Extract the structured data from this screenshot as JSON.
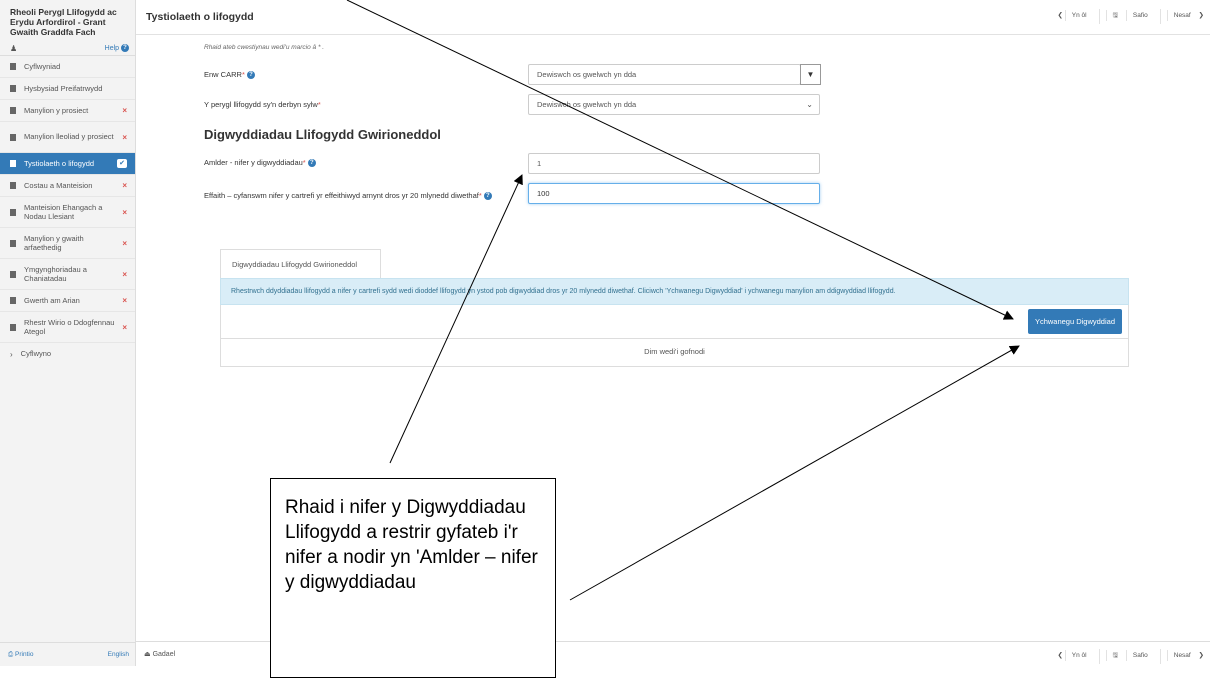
{
  "sidebar": {
    "title": "Rheoli Perygl Llifogydd ac Erydu Arfordirol - Grant Gwaith Graddfa Fach",
    "help": "Help",
    "items": [
      {
        "label": "Cyflwyniad",
        "mark": ""
      },
      {
        "label": "Hysbysiad Preifatrwydd",
        "mark": ""
      },
      {
        "label": "Manylion y prosiect",
        "mark": "×"
      },
      {
        "label": "Manylion lleoliad y prosiect",
        "mark": "×"
      },
      {
        "label": "Tystiolaeth o lifogydd",
        "mark": "✔"
      },
      {
        "label": "Costau a Manteision",
        "mark": "×"
      },
      {
        "label": "Manteision Ehangach a Nodau Llesiant",
        "mark": "×"
      },
      {
        "label": "Manylion y gwaith arfaethedig",
        "mark": "×"
      },
      {
        "label": "Ymgynghoriadau a Chaniatadau",
        "mark": "×"
      },
      {
        "label": "Gwerth am Arian",
        "mark": "×"
      },
      {
        "label": "Rhestr Wirio o Ddogfennau Ategol",
        "mark": "×"
      },
      {
        "label": "Cyflwyno",
        "mark": ""
      }
    ],
    "print": "Printio",
    "language": "English"
  },
  "header": {
    "title": "Tystiolaeth o lifogydd",
    "back": "Yn ôl",
    "save": "Safio",
    "next": "Nesaf"
  },
  "footer": {
    "leave": "Gadael"
  },
  "form": {
    "required_note": "Rhaid ateb cwestiynau wedi'u marcio â * .",
    "carr_label": "Enw CARR",
    "carr_placeholder": "Dewiswch os gwelwch yn dda",
    "risk_label": "Y perygl llifogydd sy'n derbyn sylw",
    "risk_value": "Dewiswch os gwelwch yn dda",
    "section_heading": "Digwyddiadau Llifogydd Gwirioneddol",
    "freq_label": "Amlder - nifer y digwyddiadau",
    "freq_value": "1",
    "impact_label": "Effaith – cyfanswm nifer y cartrefi yr effeithiwyd arnynt dros yr 20 mlynedd diwethaf",
    "impact_value": "100"
  },
  "panel": {
    "tab": "Digwyddiadau Llifogydd Gwirioneddol",
    "info": "Rhestrwch ddyddiadau llifogydd a nifer y cartrefi sydd wedi dioddef llifogydd yn ystod pob digwyddiad dros yr 20 mlynedd diwethaf. Cliciwch 'Ychwanegu Digwyddiad' i ychwanegu manylion am ddigwyddiad llifogydd.",
    "add_button": "Ychwanegu Digwyddiad",
    "empty": "Dim wedi'i gofnodi"
  },
  "annotation": {
    "text": "Rhaid i nifer y Digwyddiadau Llifogydd a restrir gyfateb i'r nifer a nodir yn 'Amlder – nifer y digwyddiadau"
  }
}
